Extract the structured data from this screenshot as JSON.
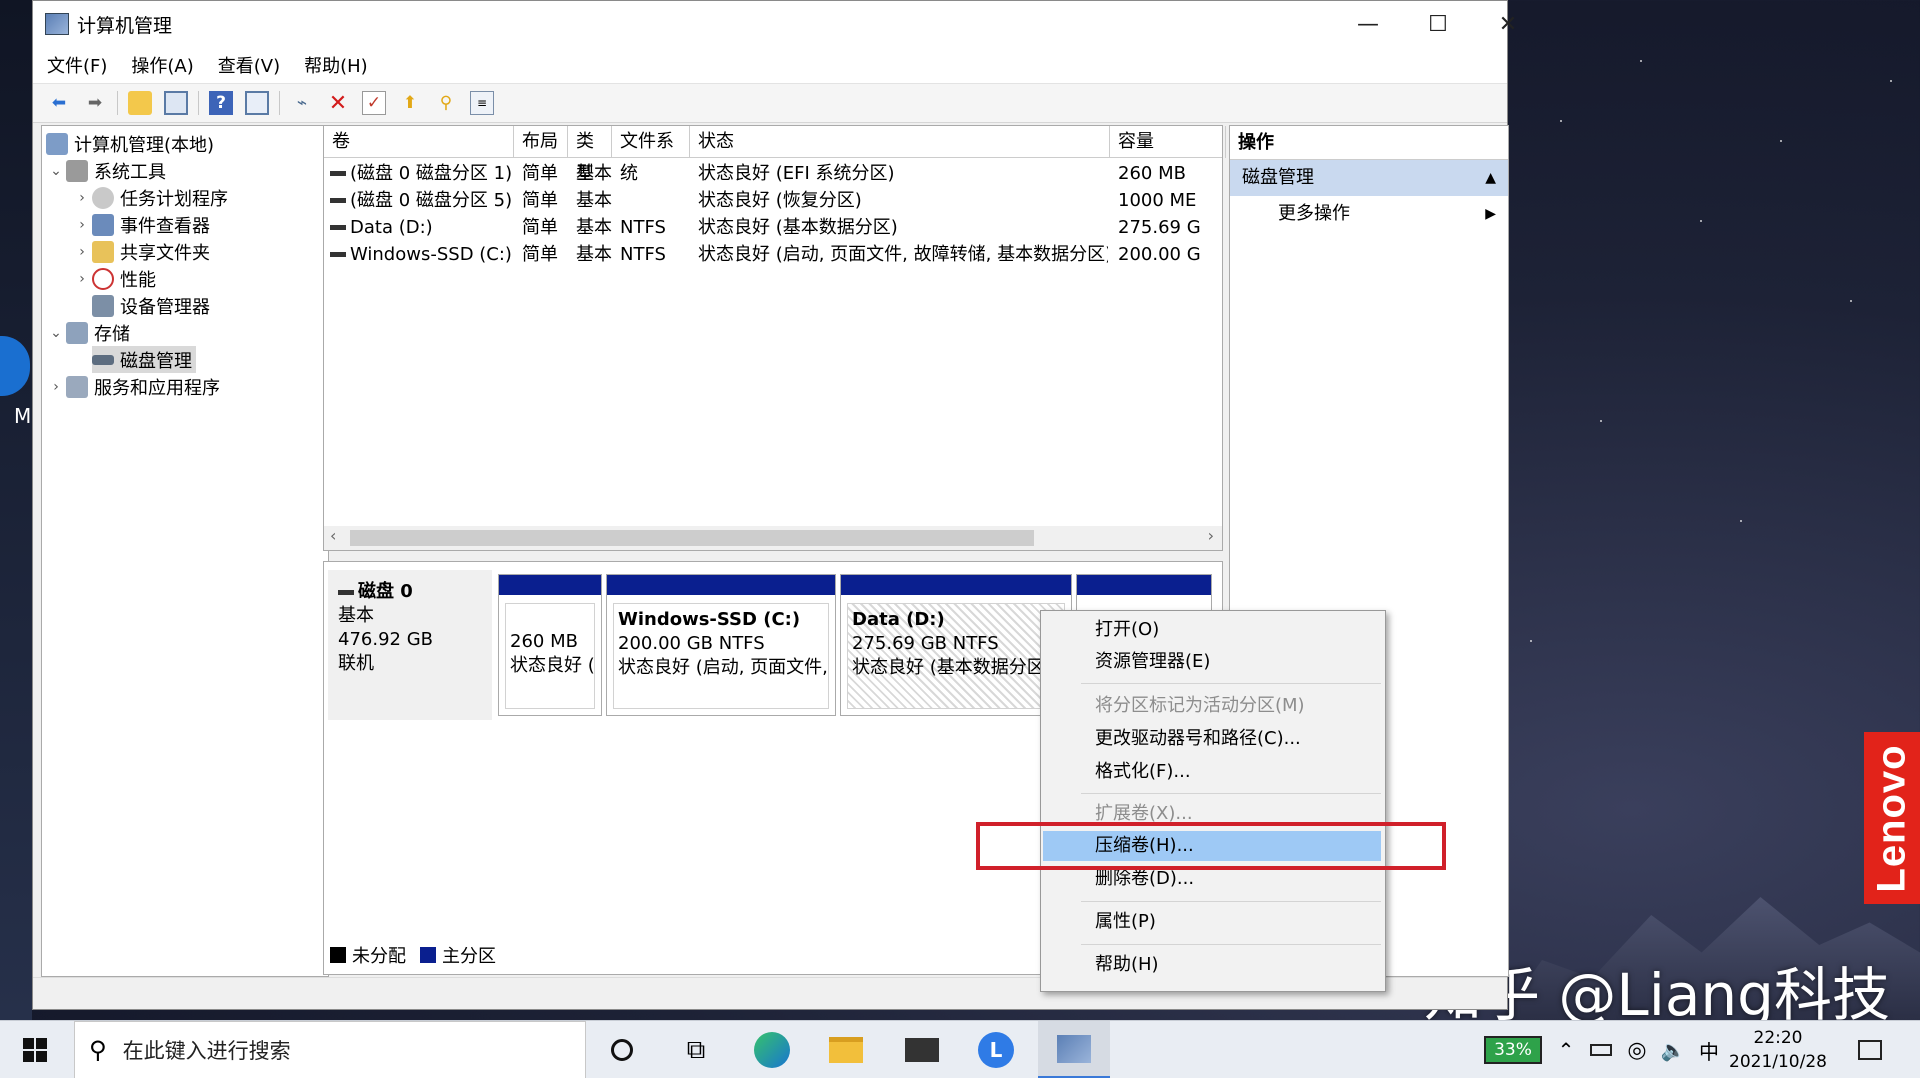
{
  "window": {
    "title": "计算机管理",
    "controls": {
      "minimize": "—",
      "maximize": "☐",
      "close": "✕"
    }
  },
  "menubar": [
    "文件(F)",
    "操作(A)",
    "查看(V)",
    "帮助(H)"
  ],
  "toolbar_icons": [
    "back-icon",
    "forward-icon",
    "up-folder-icon",
    "show-tree-icon",
    "help-icon",
    "properties-icon",
    "connect-icon",
    "delete-icon",
    "check-icon",
    "export-icon",
    "search-icon",
    "list-icon"
  ],
  "tree": {
    "root": "计算机管理(本地)",
    "system_tools": "系统工具",
    "task_scheduler": "任务计划程序",
    "event_viewer": "事件查看器",
    "shared_folders": "共享文件夹",
    "performance": "性能",
    "device_manager": "设备管理器",
    "storage": "存储",
    "disk_management": "磁盘管理",
    "services_apps": "服务和应用程序"
  },
  "volumes": {
    "headers": [
      "卷",
      "布局",
      "类型",
      "文件系统",
      "状态",
      "容量"
    ],
    "rows": [
      {
        "name": "(磁盘 0 磁盘分区 1)",
        "layout": "简单",
        "type": "基本",
        "fs": "",
        "status": "状态良好 (EFI 系统分区)",
        "capacity": "260 MB"
      },
      {
        "name": "(磁盘 0 磁盘分区 5)",
        "layout": "简单",
        "type": "基本",
        "fs": "",
        "status": "状态良好 (恢复分区)",
        "capacity": "1000 ME"
      },
      {
        "name": "Data (D:)",
        "layout": "简单",
        "type": "基本",
        "fs": "NTFS",
        "status": "状态良好 (基本数据分区)",
        "capacity": "275.69 G"
      },
      {
        "name": "Windows-SSD (C:)",
        "layout": "简单",
        "type": "基本",
        "fs": "NTFS",
        "status": "状态良好 (启动, 页面文件, 故障转储, 基本数据分区)",
        "capacity": "200.00 G"
      }
    ]
  },
  "disk": {
    "name": "磁盘 0",
    "kind": "基本",
    "size": "476.92 GB",
    "state": "联机",
    "partitions": [
      {
        "title": "",
        "line1": "260 MB",
        "line2": "状态良好 ("
      },
      {
        "title": "Windows-SSD  (C:)",
        "line1": "200.00 GB NTFS",
        "line2": "状态良好 (启动, 页面文件, i"
      },
      {
        "title": "Data  (D:)",
        "line1": "275.69 GB NTFS",
        "line2": "状态良好 (基本数据分区"
      }
    ],
    "legend": {
      "unallocated": "未分配",
      "primary": "主分区"
    }
  },
  "actions": {
    "header": "操作",
    "section": "磁盘管理",
    "more": "更多操作"
  },
  "context_menu": [
    {
      "label": "打开(O)",
      "enabled": true
    },
    {
      "label": "资源管理器(E)",
      "enabled": true
    },
    {
      "label": "将分区标记为活动分区(M)",
      "enabled": false
    },
    {
      "label": "更改驱动器号和路径(C)...",
      "enabled": true
    },
    {
      "label": "格式化(F)...",
      "enabled": true
    },
    {
      "label": "扩展卷(X)...",
      "enabled": false
    },
    {
      "label": "压缩卷(H)...",
      "enabled": true,
      "highlighted": true
    },
    {
      "label": "删除卷(D)...",
      "enabled": true
    },
    {
      "label": "属性(P)",
      "enabled": true
    },
    {
      "label": "帮助(H)",
      "enabled": true
    }
  ],
  "desktop": {
    "icon_label": "M",
    "brand": "Lenovo",
    "watermark": "知乎 @Liang科技"
  },
  "taskbar": {
    "search_placeholder": "在此键入进行搜索",
    "battery": "33%",
    "ime": "中",
    "time": "22:20",
    "date": "2021/10/28"
  },
  "colors": {
    "primary_partition": "#0a1f8f",
    "unallocated": "#000000",
    "highlight": "#9ec9f5",
    "callout": "#d0202a",
    "brand": "#e2231a"
  }
}
